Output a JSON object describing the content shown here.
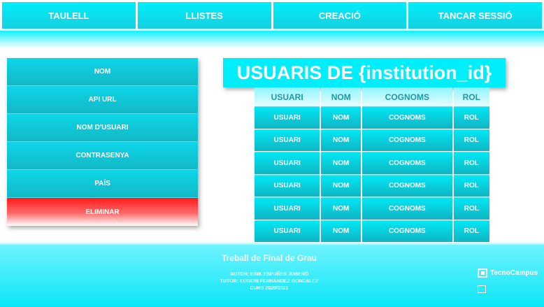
{
  "nav": {
    "items": [
      {
        "label": "TAULELL"
      },
      {
        "label": "LLISTES"
      },
      {
        "label": "CREACIÓ"
      },
      {
        "label": "TANCAR SESSIÓ"
      }
    ]
  },
  "sidebar": {
    "items": [
      {
        "label": "NOM"
      },
      {
        "label": "API URL"
      },
      {
        "label": "NOM D'USUARI"
      },
      {
        "label": "CONTRASENYA"
      },
      {
        "label": "PAÍS"
      },
      {
        "label": "ELIMINAR"
      }
    ]
  },
  "main": {
    "title": "USUARIS DE {institution_id}",
    "table": {
      "headers": [
        "USUARI",
        "NOM",
        "COGNOMS",
        "ROL"
      ],
      "rows": [
        [
          "USUARI",
          "NOM",
          "COGNOMS",
          "ROL"
        ],
        [
          "USUARI",
          "NOM",
          "COGNOMS",
          "ROL"
        ],
        [
          "USUARI",
          "NOM",
          "COGNOMS",
          "ROL"
        ],
        [
          "USUARI",
          "NOM",
          "COGNOMS",
          "ROL"
        ],
        [
          "USUARI",
          "NOM",
          "COGNOMS",
          "ROL"
        ],
        [
          "USUARI",
          "NOM",
          "COGNOMS",
          "ROL"
        ]
      ]
    }
  },
  "footer": {
    "title": "Treball de Final de Grau",
    "author": "AUTOR: ERIK ESPUÑES JUBERÓ",
    "tutor": "TUTOR: EUGENI FERNANDEZ GONZALEZ",
    "course": "CURS 2020/2021",
    "logo_text": "TecnoCampus"
  },
  "colors": {
    "accent": "#00eefa",
    "danger": "#ff1a1a"
  }
}
